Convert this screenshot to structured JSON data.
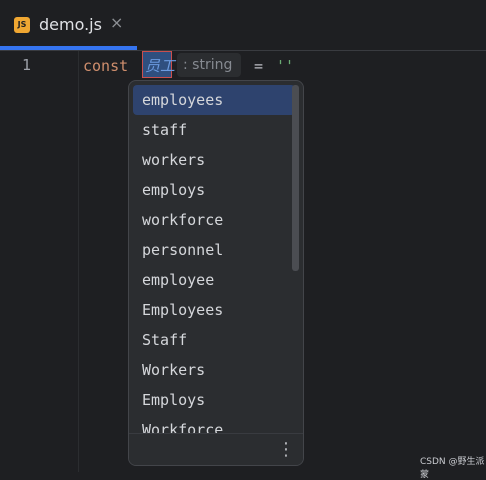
{
  "tab": {
    "icon_text": "JS",
    "title": "demo.js",
    "close_glyph": "×"
  },
  "editor": {
    "line_number": "1",
    "keyword": "const",
    "identifier": "员工",
    "type_hint": ": string",
    "equals": "=",
    "string_literal": "''"
  },
  "autocomplete": {
    "items": [
      {
        "label": "employees",
        "selected": true
      },
      {
        "label": "staff"
      },
      {
        "label": "workers"
      },
      {
        "label": "employs"
      },
      {
        "label": "workforce"
      },
      {
        "label": "personnel"
      },
      {
        "label": "employee"
      },
      {
        "label": "Employees"
      },
      {
        "label": "Staff"
      },
      {
        "label": "Workers"
      },
      {
        "label": "Employs"
      },
      {
        "label": "Workforce"
      }
    ],
    "more_icon": "⋮"
  },
  "watermark": "CSDN @野生派蒙",
  "colors": {
    "accent": "#3574f0",
    "keyword": "#cf8e6d",
    "string": "#6aab73",
    "selected_bg": "#2e436e"
  }
}
